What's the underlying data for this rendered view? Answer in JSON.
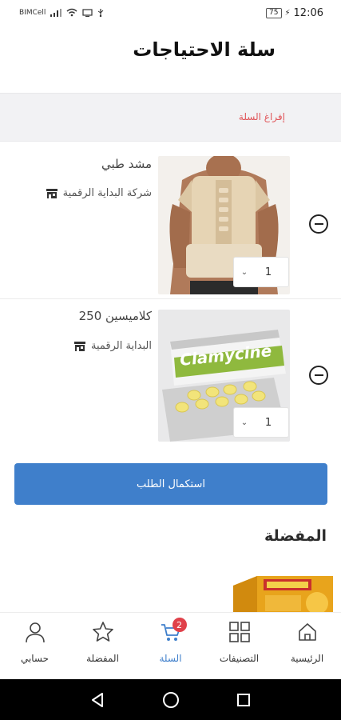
{
  "status_bar": {
    "carrier": "BIMCell",
    "battery": "75",
    "time": "12:06"
  },
  "page": {
    "title": "سلة الاحتياجات",
    "clear_cart": "إفراغ السلة"
  },
  "cart_items": [
    {
      "name": "مشد طبي",
      "store": "شركة البداية الرقمية",
      "quantity": "1"
    },
    {
      "name": "كلاميسين 250",
      "store": "البداية الرقمية",
      "quantity": "1",
      "image_text": "Clamycine"
    }
  ],
  "checkout_label": "استكمال الطلب",
  "favorites_title": "المفضلة",
  "bottom_nav": [
    {
      "label": "الرئيسية",
      "icon": "home-icon"
    },
    {
      "label": "التصنيفات",
      "icon": "grid-icon"
    },
    {
      "label": "السلة",
      "icon": "cart-icon",
      "badge": "2",
      "active": true
    },
    {
      "label": "المفضلة",
      "icon": "star-icon"
    },
    {
      "label": "حسابي",
      "icon": "user-icon"
    }
  ],
  "colors": {
    "accent": "#3f7fcb",
    "danger": "#e0565a",
    "badge": "#e0414a"
  }
}
